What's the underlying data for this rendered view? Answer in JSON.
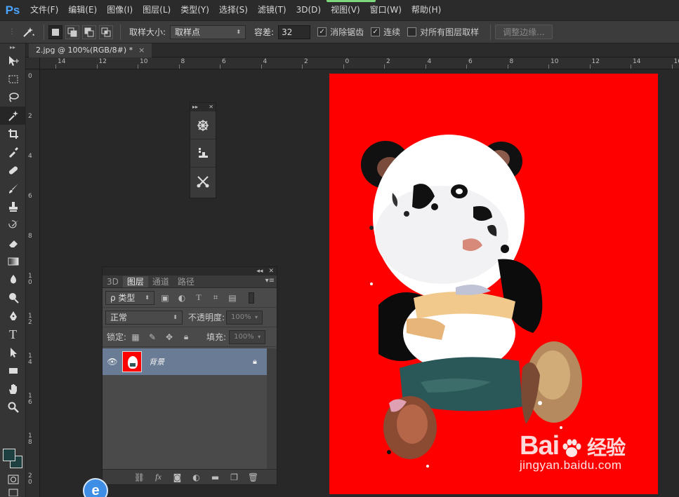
{
  "app": {
    "logo": "Ps",
    "menu": [
      "文件(F)",
      "编辑(E)",
      "图像(I)",
      "图层(L)",
      "类型(Y)",
      "选择(S)",
      "滤镜(T)",
      "3D(D)",
      "视图(V)",
      "窗口(W)",
      "帮助(H)"
    ]
  },
  "options": {
    "sample_size_label": "取样大小:",
    "sample_size_value": "取样点",
    "tolerance_label": "容差:",
    "tolerance_value": "32",
    "antialias_label": "消除锯齿",
    "antialias_checked": true,
    "contiguous_label": "连续",
    "contiguous_checked": true,
    "sample_all_label": "对所有图层取样",
    "sample_all_checked": false,
    "refine_edge_label": "调整边缘..."
  },
  "document": {
    "tab_title": "2.jpg @ 100%(RGB/8#) *",
    "close_glyph": "×"
  },
  "rulers": {
    "horizontal": [
      "14",
      "12",
      "10",
      "8",
      "6",
      "4",
      "2",
      "0",
      "2",
      "4",
      "6",
      "8",
      "10",
      "12",
      "14",
      "16"
    ],
    "vertical": [
      "0",
      "2",
      "4",
      "6",
      "8",
      "1\n0",
      "1\n2",
      "1\n4",
      "1\n6",
      "1\n8",
      "2\n0"
    ]
  },
  "layers_panel": {
    "tabs": [
      "3D",
      "图层",
      "通道",
      "路径"
    ],
    "active_tab": "图层",
    "filter_label": "ρ 类型",
    "blend_mode": "正常",
    "opacity_label": "不透明度:",
    "opacity_value": "100%",
    "lock_label": "锁定:",
    "fill_label": "填充:",
    "fill_value": "100%",
    "layer_name": "背景"
  },
  "watermark": {
    "brand": "Bai",
    "brand_suffix": "经验",
    "url": "jingyan.baidu.com"
  },
  "colors": {
    "foreground": "#1e4040",
    "background": "#1e4040",
    "canvas_fill": "#ff0000",
    "layer_selected": "#6a7c95"
  }
}
